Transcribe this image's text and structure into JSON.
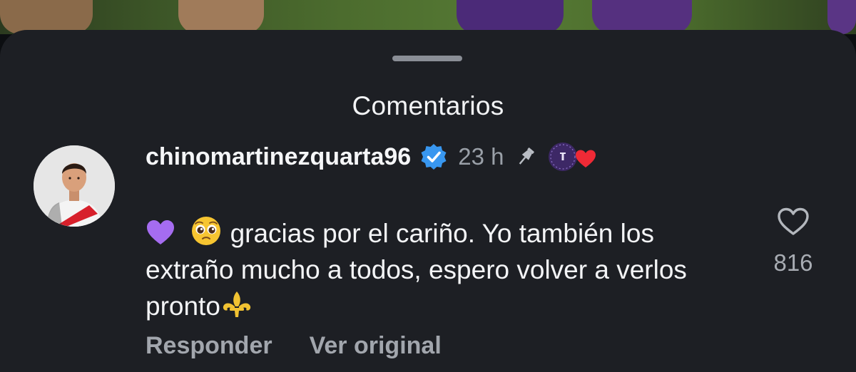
{
  "sheet": {
    "title": "Comentarios"
  },
  "comment": {
    "username": "chinomartinezquarta96",
    "verified": true,
    "timestamp": "23 h",
    "pinned": true,
    "text": "gracias por el cariño. Yo también los extraño mucho a todos, espero volver a verlos pronto",
    "leading_emojis": [
      "purple-heart",
      "pleading-face"
    ],
    "trailing_emoji": "fleur-de-lis",
    "like_count": "816",
    "reply_label": "Responder",
    "translate_label": "Ver original",
    "reaction_badge": "creator-liked-heart"
  },
  "colors": {
    "sheet_background": "#1d1f24",
    "verified_blue": "#3897f0",
    "heart_red": "#ef2a36",
    "purple_heart": "#a56cf0",
    "muted_text": "#a2a6ad"
  }
}
